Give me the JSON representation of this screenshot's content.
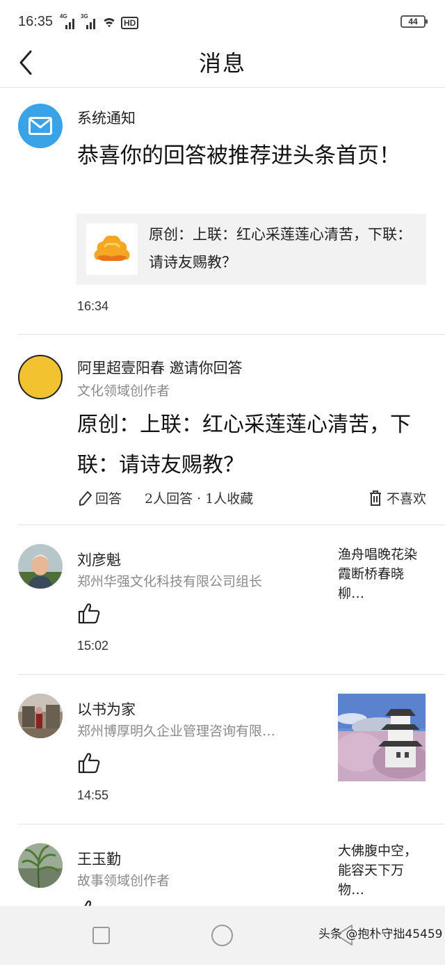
{
  "status_bar": {
    "time": "16:35",
    "signal1_label": "4G",
    "signal2_label": "3G",
    "hd_label": "HD",
    "battery": "44"
  },
  "header": {
    "title": "消息"
  },
  "system_notice": {
    "name": "系统通知",
    "title": "恭喜你的回答被推荐进头条首页！",
    "card_text": "原创：上联：红心采莲莲心清苦，下联：请诗友赐教？",
    "time": "16:34"
  },
  "invite": {
    "name": "阿里超壹阳春 邀请你回答",
    "subtitle": "文化领域创作者",
    "question": "原创：上联：红心采莲莲心清苦，下联：请诗友赐教？",
    "answer_label": "回答",
    "stats": "2人回答 · 1人收藏",
    "dislike_label": "不喜欢"
  },
  "likes": [
    {
      "name": "刘彦魁",
      "subtitle": "郑州华强文化科技有限公司组长",
      "side_text": "渔舟唱晚花染霞断桥春晓柳…",
      "time": "15:02"
    },
    {
      "name": "以书为家",
      "subtitle": "郑州博厚明久企业管理咨询有限…",
      "time": "14:55"
    },
    {
      "name": "王玉勤",
      "subtitle": "故事领域创作者",
      "side_text": "大佛腹中空，能容天下万物…"
    }
  ],
  "nav": {
    "watermark": "头条 @抱朴守拙45459"
  },
  "colors": {
    "mail_blue": "#3aa3e8",
    "avatar_yellow": "#f2c230",
    "card_bg": "#f2f2f2",
    "nav_bg": "#f2f2f2"
  }
}
